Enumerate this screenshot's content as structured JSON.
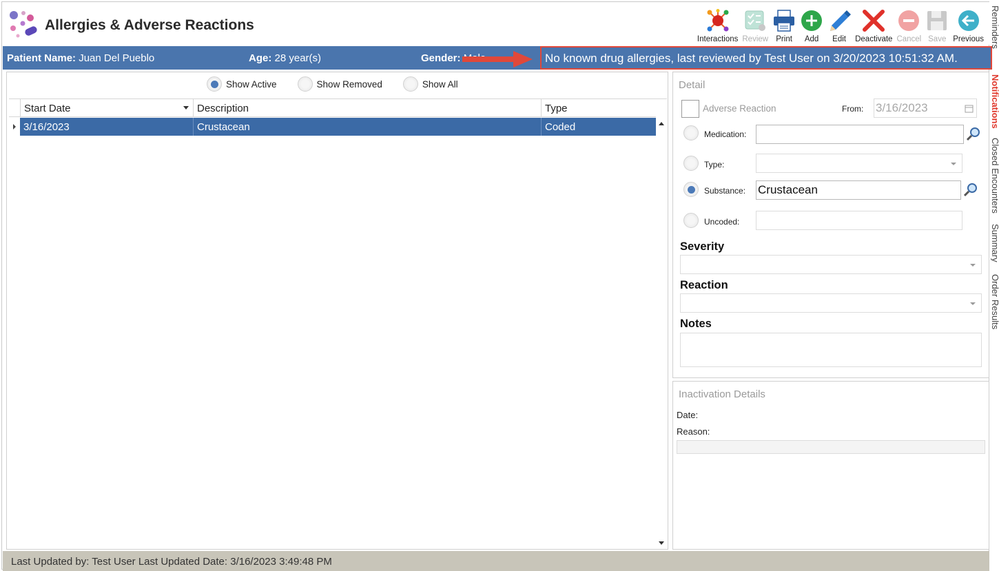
{
  "app": {
    "title": "Allergies & Adverse Reactions"
  },
  "toolbar": {
    "buttons": [
      {
        "label": "Interactions",
        "icon": "interactions-icon",
        "enabled": true
      },
      {
        "label": "Review",
        "icon": "review-icon",
        "enabled": false
      },
      {
        "label": "Print",
        "icon": "printer-icon",
        "enabled": true
      },
      {
        "label": "Add",
        "icon": "plus-circle-icon",
        "enabled": true
      },
      {
        "label": "Edit",
        "icon": "pencil-icon",
        "enabled": true
      },
      {
        "label": "Deactivate",
        "icon": "red-x-icon",
        "enabled": true
      },
      {
        "label": "Cancel",
        "icon": "minus-circle-icon",
        "enabled": false
      },
      {
        "label": "Save",
        "icon": "floppy-disk-icon",
        "enabled": false
      },
      {
        "label": "Previous",
        "icon": "back-arrow-icon",
        "enabled": true
      }
    ]
  },
  "patient": {
    "name_label": "Patient Name:",
    "name_value": "Juan Del Pueblo",
    "age_label": "Age:",
    "age_value": "28 year(s)",
    "gender_label": "Gender:",
    "gender_value": "Male"
  },
  "alert": {
    "message": "No known drug allergies, last reviewed by Test User on 3/20/2023 10:51:32 AM."
  },
  "filters": {
    "options": [
      "Show Active",
      "Show Removed",
      "Show All"
    ],
    "selected": "Show Active"
  },
  "grid": {
    "columns": [
      "Start Date",
      "Description",
      "Type"
    ],
    "rows": [
      {
        "start_date": "3/16/2023",
        "description": "Crustacean",
        "type": "Coded"
      }
    ]
  },
  "detail": {
    "section_title": "Detail",
    "adverse_reaction_label": "Adverse Reaction",
    "from_label": "From:",
    "from_value": "3/16/2023",
    "medication_label": "Medication:",
    "medication_value": "",
    "type_label": "Type:",
    "type_value": "",
    "substance_label": "Substance:",
    "substance_value": "Crustacean",
    "uncoded_label": "Uncoded:",
    "uncoded_value": "",
    "selected_source": "Substance",
    "severity_label": "Severity",
    "reaction_label": "Reaction",
    "notes_label": "Notes"
  },
  "inactivation": {
    "section_title": "Inactivation Details",
    "date_label": "Date:",
    "reason_label": "Reason:"
  },
  "footer": {
    "text": "Last Updated by:  Test User  Last Updated Date: 3/16/2023 3:49:48 PM"
  },
  "side_tabs": [
    "Reminders",
    "Notifications",
    "Closed Encounters",
    "Summary",
    "Order Results"
  ],
  "colors": {
    "patient_bar": "#4a75ad",
    "selected_row": "#3b6aa6",
    "alert_border": "#e0483a",
    "footer": "#c8c5b9"
  }
}
